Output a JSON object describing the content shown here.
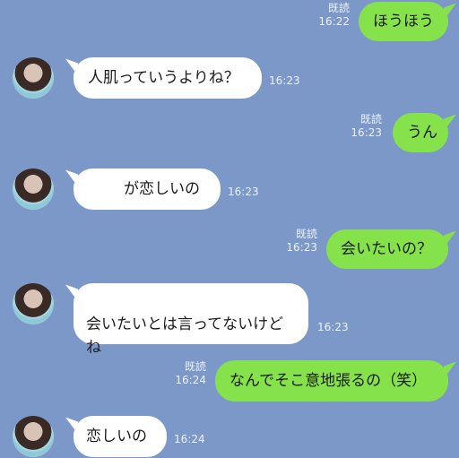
{
  "messages": [
    {
      "side": "out",
      "text": "ほうほう",
      "read": "既読",
      "time": "16:22"
    },
    {
      "side": "in",
      "text": "人肌っていうよりね？",
      "time": "16:23"
    },
    {
      "side": "out",
      "text": "うん",
      "read": "既読",
      "time": "16:23"
    },
    {
      "side": "in",
      "text": "が恋しいの",
      "time": "16:23"
    },
    {
      "side": "out",
      "text": "会いたいの？",
      "read": "既読",
      "time": "16:23"
    },
    {
      "side": "in",
      "text": "会いたいとは言ってないけど\nね",
      "time": "16:23"
    },
    {
      "side": "out",
      "text": "なんでそこ意地張るの（笑）",
      "read": "既読",
      "time": "16:24"
    },
    {
      "side": "in",
      "text": "恋しいの",
      "time": "16:24"
    }
  ]
}
